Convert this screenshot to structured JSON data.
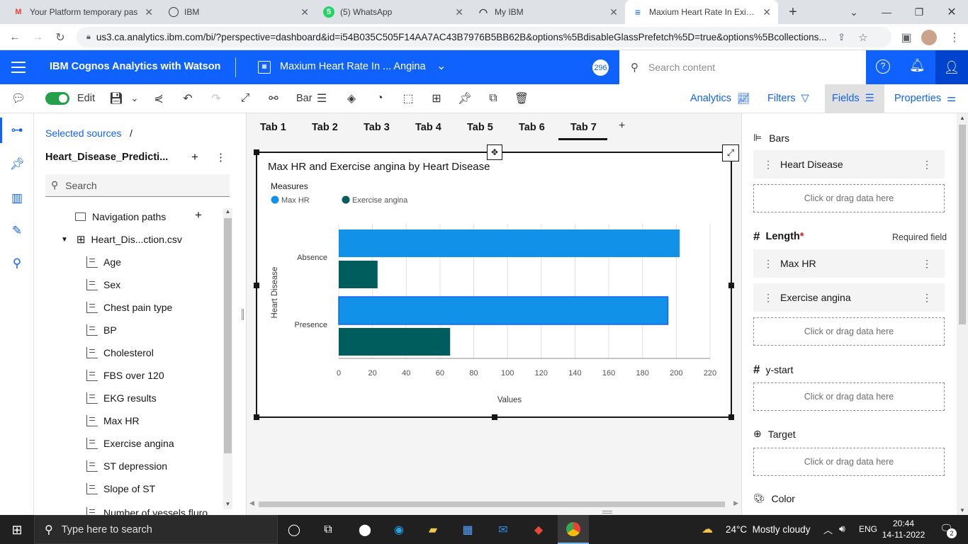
{
  "browser_tabs": [
    {
      "title": "Your Platform temporary pas",
      "icon": "gmail-icon"
    },
    {
      "title": "IBM",
      "icon": "globe-icon"
    },
    {
      "title": "(5) WhatsApp",
      "icon": "whatsapp-icon"
    },
    {
      "title": "My IBM",
      "icon": "ibm-icon"
    },
    {
      "title": "Maxium Heart Rate In Existin",
      "icon": "cognos-icon"
    }
  ],
  "address": {
    "url": "us3.ca.analytics.ibm.com/bi/?perspective=dashboard&id=i54B035C505F14AA7AC43B7976B5BB62B&options%5BdisableGlassPrefetch%5D=true&options%5Bcollections..."
  },
  "header": {
    "product": "IBM Cognos Analytics with Watson",
    "dashboard_title": "Maxium Heart Rate In ... Angina",
    "notif_count": "296",
    "search_placeholder": "Search content"
  },
  "toolbar": {
    "edit_label": "Edit",
    "viz_label": "Bar",
    "analytics_label": "Analytics",
    "filters_label": "Filters",
    "fields_label": "Fields",
    "properties_label": "Properties"
  },
  "sources": {
    "breadcrumb": "Selected sources",
    "breadcrumb_sep": "/",
    "source_name": "Heart_Disease_Predicti...",
    "search_placeholder": "Search",
    "nav_paths": "Navigation paths",
    "table": "Heart_Dis...ction.csv",
    "fields": [
      "Age",
      "Sex",
      "Chest pain type",
      "BP",
      "Cholesterol",
      "FBS over 120",
      "EKG results",
      "Max HR",
      "Exercise angina",
      "ST depression",
      "Slope of ST",
      "Number of vessels fluro"
    ]
  },
  "canvas": {
    "tabs": [
      "Tab 1",
      "Tab 2",
      "Tab 3",
      "Tab 4",
      "Tab 5",
      "Tab 6",
      "Tab 7"
    ],
    "active_tab": 6
  },
  "chart_data": {
    "type": "bar",
    "orientation": "horizontal",
    "title": "Max HR and Exercise angina by Heart Disease",
    "legend_title": "Measures",
    "categories": [
      "Absence",
      "Presence"
    ],
    "series": [
      {
        "name": "Max HR",
        "values": [
          202,
          195
        ],
        "color": "#1192e8"
      },
      {
        "name": "Exercise angina",
        "values": [
          23,
          66
        ],
        "color": "#005d5d"
      }
    ],
    "xlabel": "Values",
    "ylabel": "Heart Disease",
    "xlim": [
      0,
      220
    ],
    "xticks": [
      0,
      20,
      40,
      60,
      80,
      100,
      120,
      140,
      160,
      180,
      200,
      220
    ],
    "grid": true,
    "legend_position": "top-left"
  },
  "fields_panel": {
    "bars_label": "Bars",
    "bars_items": [
      "Heart Disease"
    ],
    "length_label": "Length",
    "required_marker": "*",
    "required_text": "Required field",
    "length_items": [
      "Max HR",
      "Exercise angina"
    ],
    "ystart_label": "y-start",
    "target_label": "Target",
    "color_label": "Color",
    "drop_text": "Click or drag data here"
  },
  "taskbar": {
    "search_placeholder": "Type here to search",
    "weather": "24°C  Mostly cloudy",
    "lang": "ENG",
    "time": "20:44",
    "date": "14-11-2022",
    "notif_count": "2"
  },
  "colors": {
    "accent": "#0f62fe",
    "chart_blue": "#1192e8",
    "chart_teal": "#005d5d",
    "toggle_green": "#24a148"
  }
}
